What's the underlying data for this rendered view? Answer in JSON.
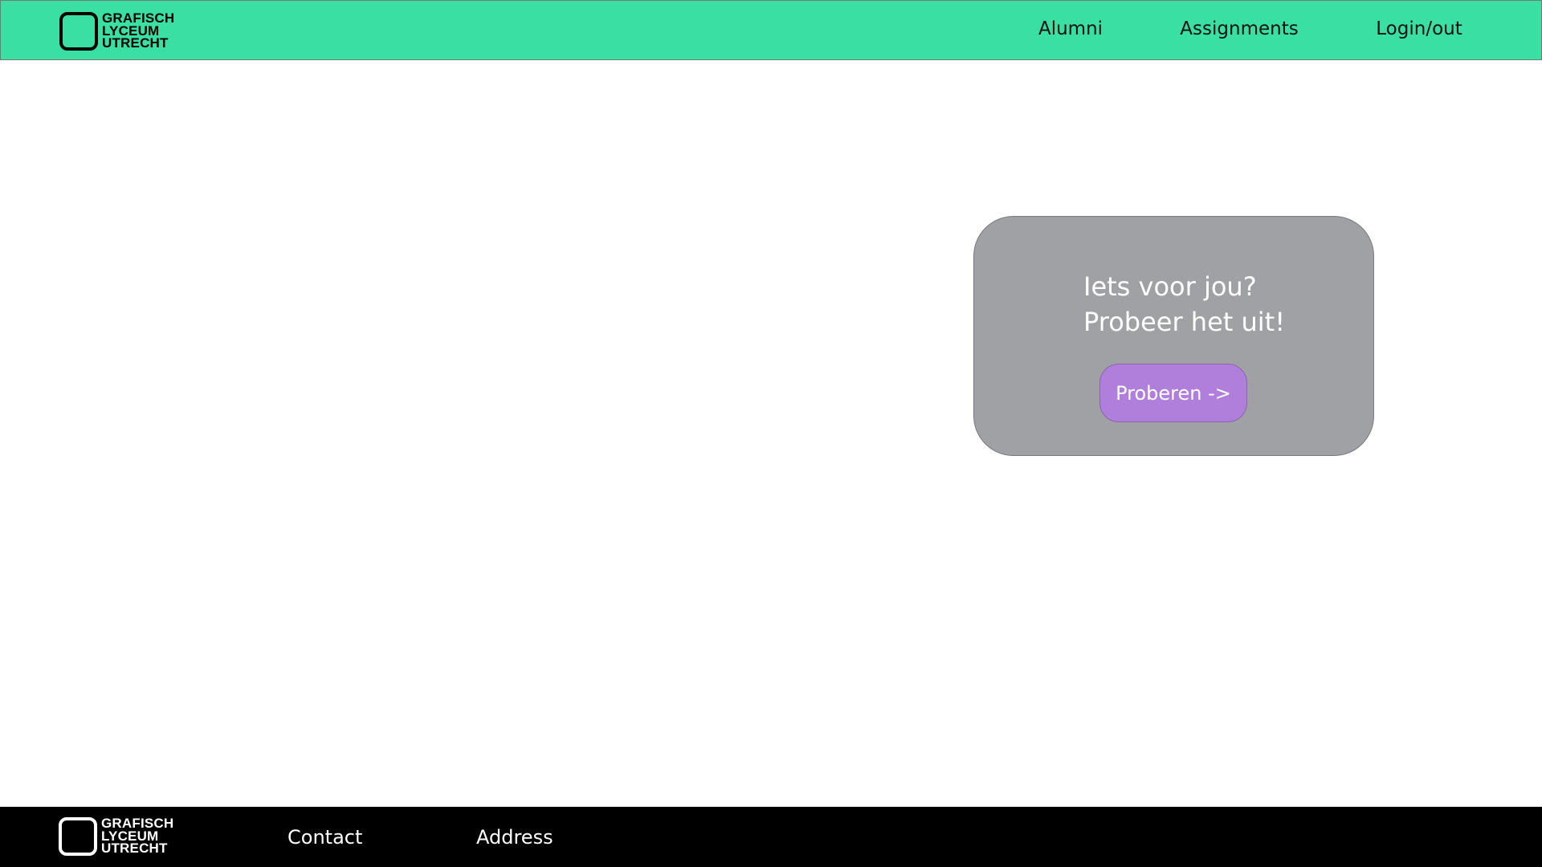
{
  "brand": {
    "logo_text": [
      "GRAFISCH",
      "LYCEUM",
      "UTRECHT"
    ]
  },
  "nav": {
    "items": [
      {
        "label": "Alumni"
      },
      {
        "label": "Assignments"
      },
      {
        "label": "Login/out"
      }
    ]
  },
  "card": {
    "line1": "Iets voor jou?",
    "line2": "Probeer het uit!",
    "button_label": "Proberen ->"
  },
  "footer": {
    "items": [
      {
        "label": "Contact"
      },
      {
        "label": "Address"
      }
    ]
  },
  "colors": {
    "nav_bg": "#3ADFA4",
    "card_bg": "#A0A1A5",
    "button_bg": "#B07FDB",
    "footer_bg": "#000000"
  }
}
